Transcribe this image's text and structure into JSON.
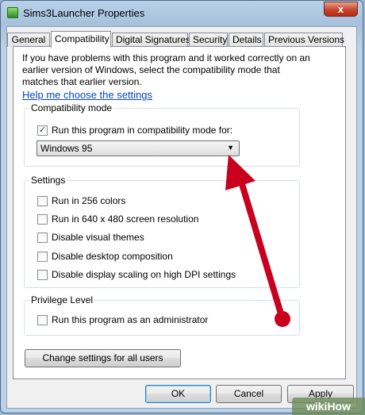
{
  "window": {
    "title": "Sims3Launcher Properties",
    "close_label": "x"
  },
  "tabs": [
    {
      "label": "General"
    },
    {
      "label": "Compatibility"
    },
    {
      "label": "Digital Signatures"
    },
    {
      "label": "Security"
    },
    {
      "label": "Details"
    },
    {
      "label": "Previous Versions"
    }
  ],
  "active_tab": "Compatibility",
  "intro": "If you have problems with this program and it worked correctly on an earlier version of Windows, select the compatibility mode that matches that earlier version.",
  "help_link": "Help me choose the settings",
  "compat_group": {
    "title": "Compatibility mode",
    "checkbox_label": "Run this program in compatibility mode for:",
    "checked": true,
    "selected_mode": "Windows 95"
  },
  "settings_group": {
    "title": "Settings",
    "items": [
      {
        "label": "Run in 256 colors",
        "checked": false
      },
      {
        "label": "Run in 640 x 480 screen resolution",
        "checked": false
      },
      {
        "label": "Disable visual themes",
        "checked": false
      },
      {
        "label": "Disable desktop composition",
        "checked": false
      },
      {
        "label": "Disable display scaling on high DPI settings",
        "checked": false
      }
    ]
  },
  "privilege_group": {
    "title": "Privilege Level",
    "checkbox_label": "Run this program as an administrator",
    "checked": false
  },
  "change_all_users": "Change settings for all users",
  "buttons": {
    "ok": "OK",
    "cancel": "Cancel",
    "apply": "Apply"
  },
  "watermark": "wikiHow",
  "colors": {
    "arrow": "#c8001e",
    "link": "#0645c8"
  }
}
